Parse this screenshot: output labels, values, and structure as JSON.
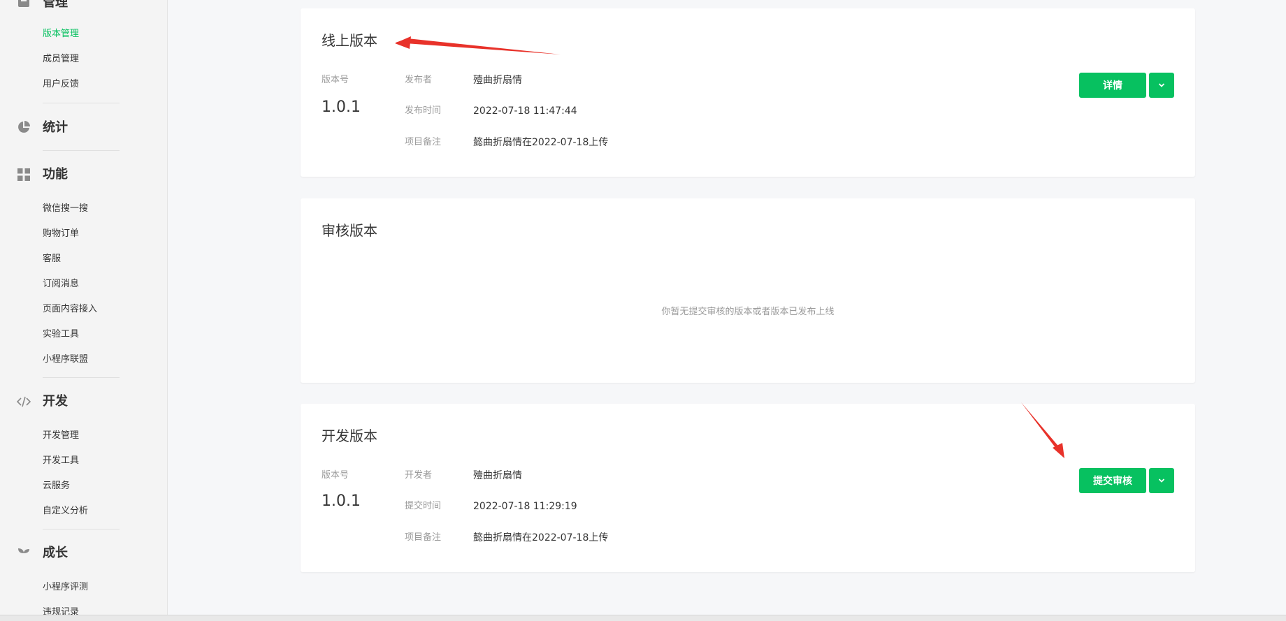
{
  "sidebar": {
    "top_group_label": "管理",
    "manage_items": [
      "版本管理",
      "成员管理",
      "用户反馈"
    ],
    "stats_label": "统计",
    "features_label": "功能",
    "feature_items": [
      "微信搜一搜",
      "购物订单",
      "客服",
      "订阅消息",
      "页面内容接入",
      "实验工具",
      "小程序联盟"
    ],
    "dev_label": "开发",
    "dev_items": [
      "开发管理",
      "开发工具",
      "云服务",
      "自定义分析"
    ],
    "growth_label": "成长",
    "growth_items": [
      "小程序评测",
      "违规记录"
    ],
    "active_color": "#07c160"
  },
  "online": {
    "title": "线上版本",
    "version_label": "版本号",
    "version": "1.0.1",
    "publisher_label": "发布者",
    "publisher": "殪曲折扇情",
    "time_label": "发布时间",
    "time": "2022-07-18 11:47:44",
    "note_label": "项目备注",
    "note": "懿曲折扇情在2022-07-18上传",
    "detail_button": "详情"
  },
  "review": {
    "title": "审核版本",
    "empty": "你暂无提交审核的版本或者版本已发布上线"
  },
  "dev": {
    "title": "开发版本",
    "version_label": "版本号",
    "version": "1.0.1",
    "developer_label": "开发者",
    "developer": "殪曲折扇情",
    "time_label": "提交时间",
    "time": "2022-07-18 11:29:19",
    "note_label": "项目备注",
    "note": "懿曲折扇情在2022-07-18上传",
    "submit_button": "提交审核"
  },
  "colors": {
    "primary": "#07c160",
    "annotation_arrow": "#e8322a"
  },
  "icons": [
    "manage-icon",
    "pie-chart-icon",
    "grid-icon",
    "code-icon",
    "sprout-icon",
    "chevron-down-icon"
  ]
}
